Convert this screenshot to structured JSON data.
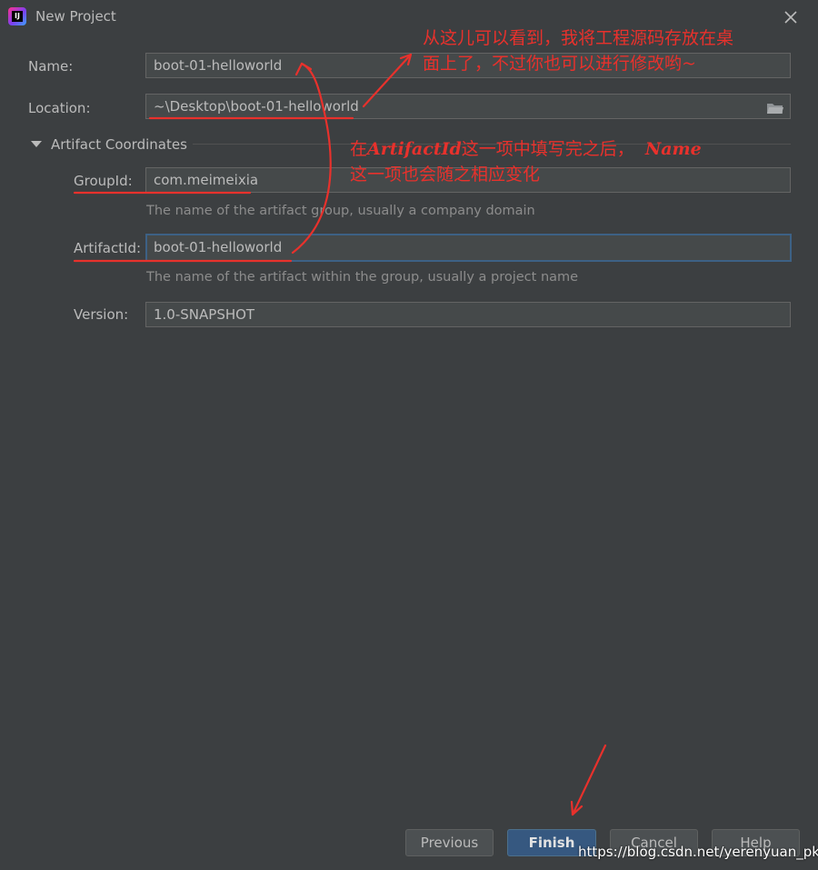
{
  "window": {
    "title": "New Project"
  },
  "form": {
    "name": {
      "label": "Name:",
      "value": "boot-01-helloworld"
    },
    "location": {
      "label": "Location:",
      "value": "~\\Desktop\\boot-01-helloworld"
    },
    "section": {
      "title": "Artifact Coordinates"
    },
    "groupId": {
      "label": "GroupId:",
      "value": "com.meimeixia",
      "hint": "The name of the artifact group, usually a company domain"
    },
    "artifactId": {
      "label": "ArtifactId:",
      "value": "boot-01-helloworld",
      "hint": "The name of the artifact within the group, usually a project name"
    },
    "version": {
      "label": "Version:",
      "value": "1.0-SNAPSHOT"
    }
  },
  "buttons": {
    "previous": "Previous",
    "finish": "Finish",
    "cancel": "Cancel",
    "help": "Help"
  },
  "annotations": {
    "note1_line1": "从这儿可以看到，我将工程源码存放在桌",
    "note1_line2": "面上了，不过你也可以进行修改哟~",
    "note2_prefix": "在",
    "note2_em1": "ArtifactId",
    "note2_mid": "这一项中填写完之后，",
    "note2_em2": "Name",
    "note2_line2": "这一项也会随之相应变化",
    "color": "#e8312c"
  },
  "watermark": "https://blog.csdn.net/yerenyuan_pku",
  "colors": {
    "background": "#3c3f41",
    "field": "#45494a",
    "focus": "#3d6185",
    "primary": "#365880"
  },
  "icons": [
    "intellij-app-icon",
    "close-icon",
    "folder-icon",
    "collapse-triangle-icon"
  ]
}
